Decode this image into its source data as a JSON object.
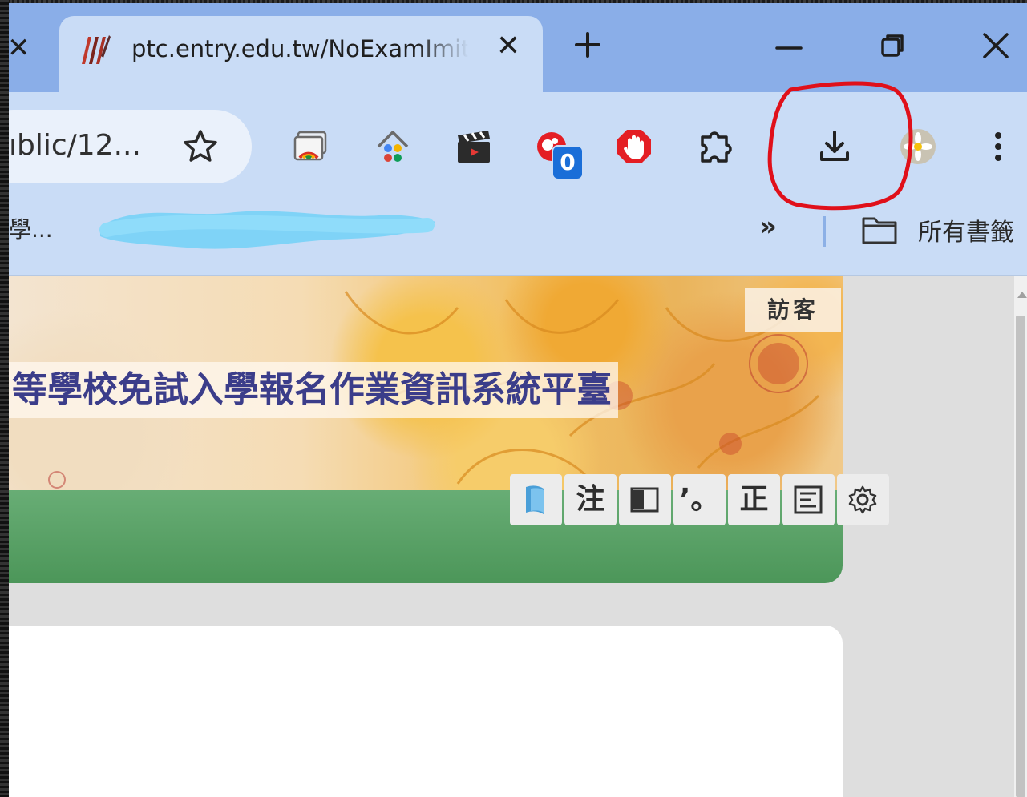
{
  "tab": {
    "title": "ptc.entry.edu.tw/NoExamImit",
    "close": "✕"
  },
  "omnibox": {
    "url_fragment": "ıblic/12..."
  },
  "bookmarks": {
    "first_item": "學...",
    "overflow": "»",
    "all_bookmarks": "所有書籤"
  },
  "extensions": {
    "badge_count": "0",
    "icons": [
      "cast-icon",
      "home-icon",
      "clapperboard-icon",
      "red-bubble-icon",
      "stop-hand-icon",
      "puzzle-icon",
      "download-icon",
      "profile-avatar",
      "menu-dots-icon"
    ]
  },
  "page": {
    "visitor_label": "訪客",
    "site_title": "等學校免試入學報名作業資訊系統平臺",
    "tools": [
      "注",
      "’。",
      "正"
    ]
  },
  "colors": {
    "tabstrip": "#8aaee8",
    "toolbar": "#c9dcf6",
    "annotation": "#e0101a",
    "badge": "#1a6ed8",
    "title_text": "#3b3d8a",
    "green_bar": "#5aa267"
  }
}
